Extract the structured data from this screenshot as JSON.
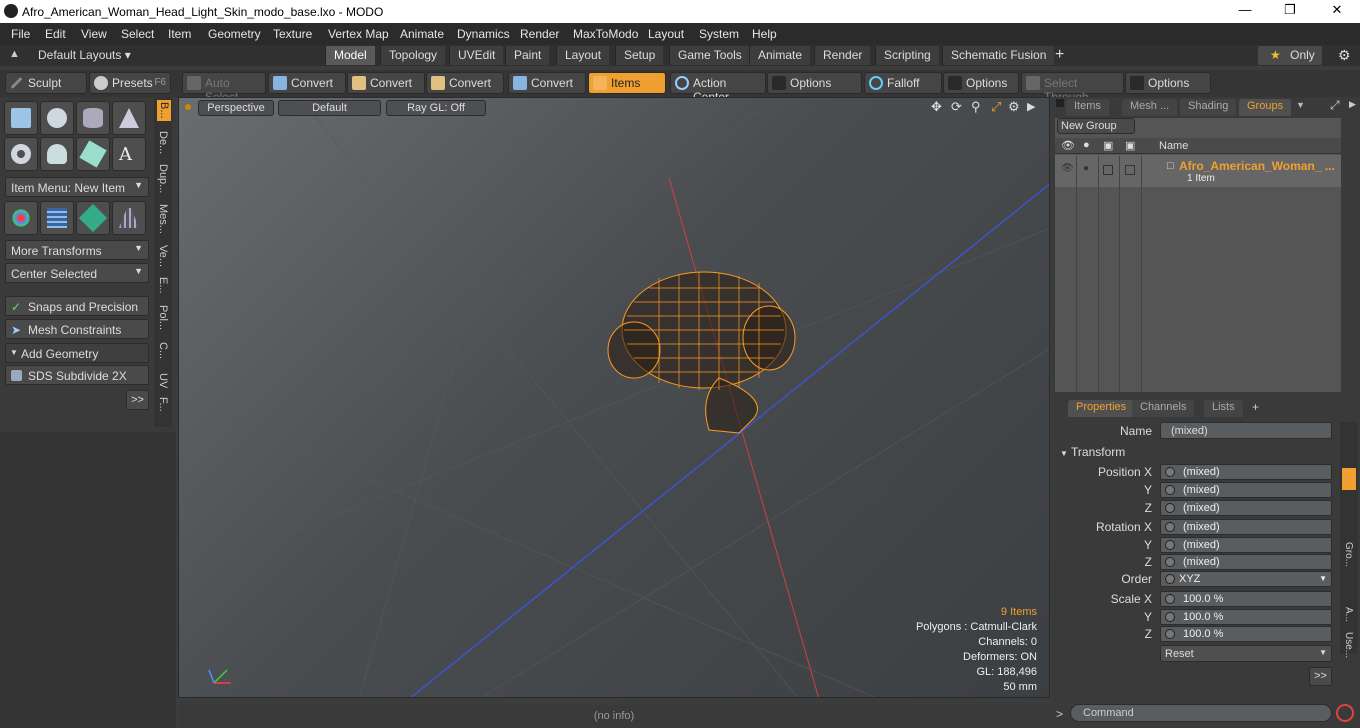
{
  "window": {
    "title": "Afro_American_Woman_Head_Light_Skin_modo_base.lxo - MODO"
  },
  "menu": [
    "File",
    "Edit",
    "View",
    "Select",
    "Item",
    "Geometry",
    "Texture",
    "Vertex Map",
    "Animate",
    "Dynamics",
    "Render",
    "MaxToModo",
    "Layout",
    "System",
    "Help"
  ],
  "layouts": {
    "label": "Default Layouts"
  },
  "tabs": [
    "Model",
    "Topology",
    "UVEdit",
    "Paint",
    "Layout",
    "Setup",
    "Game Tools",
    "Animate",
    "Render",
    "Scripting",
    "Schematic Fusion"
  ],
  "only_label": "Only",
  "toolbar": {
    "sculpt": "Sculpt",
    "presets": "Presets",
    "presets_key": "F6",
    "auto_select": "Auto Select",
    "convert1": "Convert",
    "convert2": "Convert",
    "convert3": "Convert",
    "convert4": "Convert",
    "items": "Items",
    "action_center": "Action Center",
    "options1": "Options",
    "falloff": "Falloff",
    "options2": "Options",
    "select_through": "Select Through",
    "options3": "Options"
  },
  "left": {
    "item_menu": "Item Menu: New Item",
    "more_transforms": "More Transforms",
    "center_selected": "Center Selected",
    "snaps": "Snaps and Precision",
    "mesh_constraints": "Mesh Constraints",
    "add_geometry": "Add Geometry",
    "sds": "SDS Subdivide 2X",
    "more": ">>",
    "vtabs": [
      "B...",
      "De...",
      "Dup...",
      "Mes...",
      "Ve...",
      "E...",
      "Pol...",
      "C...",
      "UV",
      "F..."
    ]
  },
  "viewport": {
    "perspective": "Perspective",
    "default": "Default",
    "raygl": "Ray GL: Off",
    "stats": {
      "items": "9 Items",
      "polygons": "Polygons : Catmull-Clark",
      "channels": "Channels: 0",
      "deformers": "Deformers: ON",
      "gl": "GL: 188,496",
      "mm": "50 mm"
    }
  },
  "status": {
    "info": "(no info)"
  },
  "right": {
    "tabs": [
      "Items",
      "Mesh ...",
      "Shading",
      "Groups"
    ],
    "new_group": "New Group",
    "col_name": "Name",
    "group_name": "Afro_American_Woman_ ...",
    "group_sub": "1 Item",
    "ptabs": [
      "Properties",
      "Channels",
      "Lists"
    ],
    "name_label": "Name",
    "name_value": "(mixed)",
    "transform": "Transform",
    "pos_label": "Position X",
    "rot_label": "Rotation X",
    "scale_label": "Scale X",
    "y": "Y",
    "z": "Z",
    "mixed": "(mixed)",
    "order_label": "Order",
    "order_value": "XYZ",
    "scale_value": "100.0 %",
    "reset": "Reset",
    "more": ">>",
    "side_tabs": [
      "Gro...",
      "A...",
      "Use..."
    ],
    "command": "Command"
  },
  "colors": {
    "accent": "#f0a030",
    "wire": "#ff9a20",
    "axis_blue": "#3b55e8",
    "axis_red": "#d04040"
  }
}
